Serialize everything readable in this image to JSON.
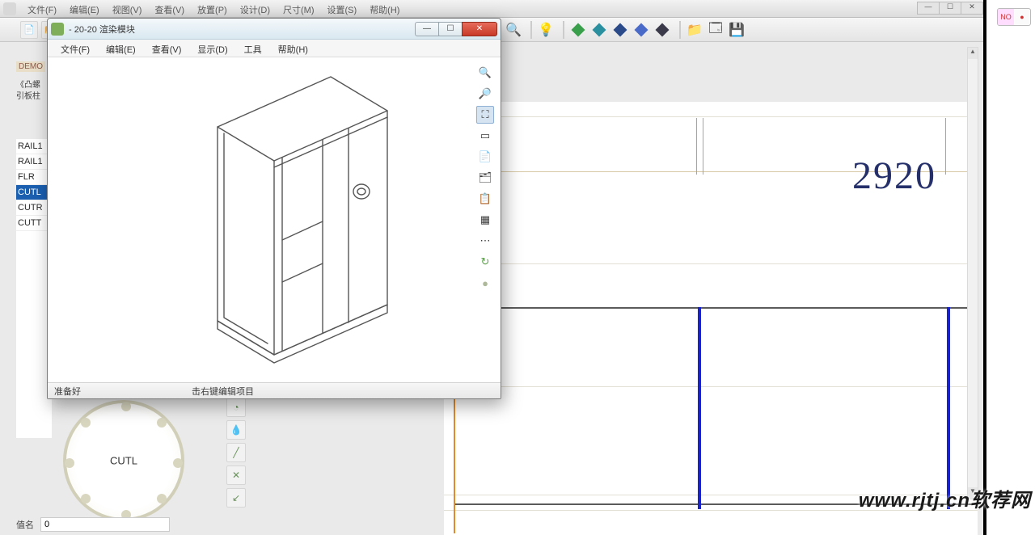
{
  "main_menu": [
    "文件(F)",
    "编辑(E)",
    "视图(V)",
    "查看(V)",
    "放置(P)",
    "设计(D)",
    "尺寸(M)",
    "设置(S)",
    "帮助(H)"
  ],
  "window_title": " - 20-20 渲染模块",
  "child_menu": [
    "文件(F)",
    "编辑(E)",
    "查看(V)",
    "显示(D)",
    "工具",
    "帮助(H)"
  ],
  "sidebar": {
    "demo": "DEMO",
    "sub1": "《凸螺",
    "sub2": "引板柱",
    "items": [
      "RAIL1",
      "RAIL1",
      "FLR",
      "CUTL",
      "CUTR",
      "CUTT"
    ],
    "selected_index": 3
  },
  "status": {
    "left": "准备好",
    "right": "击右键编辑项目"
  },
  "compass_label": "CUTL",
  "bottom": {
    "label": "值名",
    "value": "0"
  },
  "dimension": "2920",
  "toggle_label": "NO",
  "watermark": "www.rjtj.cn软荐网",
  "icons": {
    "zoom_in": "🔍+",
    "zoom_out": "🔍-",
    "pan": "✥",
    "select": "▭",
    "copy": "📄",
    "paste": "📋",
    "layers": "☰",
    "grid": "▦",
    "new": "📄",
    "save": "💾",
    "light": "💡",
    "house": "⌂"
  }
}
